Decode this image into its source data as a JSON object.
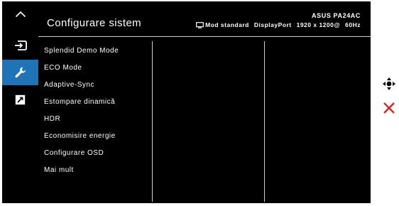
{
  "sidebar": {
    "items": [
      {
        "icon": "chevron-up-icon"
      },
      {
        "icon": "input-icon"
      },
      {
        "icon": "wrench-icon",
        "active": true
      },
      {
        "icon": "shortcut-icon"
      }
    ],
    "active_color": "#1f73b7"
  },
  "header": {
    "title": "Configurare sistem",
    "model": "ASUS PA24AC",
    "mode_label": "Mod standard",
    "input": "DisplayPort",
    "resolution": "1920 x 1200@",
    "refresh": "60Hz"
  },
  "menu": {
    "items": [
      {
        "label": "Splendid Demo Mode"
      },
      {
        "label": "ECO Mode"
      },
      {
        "label": "Adaptive-Sync"
      },
      {
        "label": "Estompare dinamică"
      },
      {
        "label": "HDR"
      },
      {
        "label": "Economisire energie"
      },
      {
        "label": "Configurare OSD"
      },
      {
        "label": "Mai mult"
      }
    ]
  },
  "right_icons": [
    {
      "icon": "navigate-icon"
    },
    {
      "icon": "close-icon",
      "color": "#e02020"
    }
  ]
}
